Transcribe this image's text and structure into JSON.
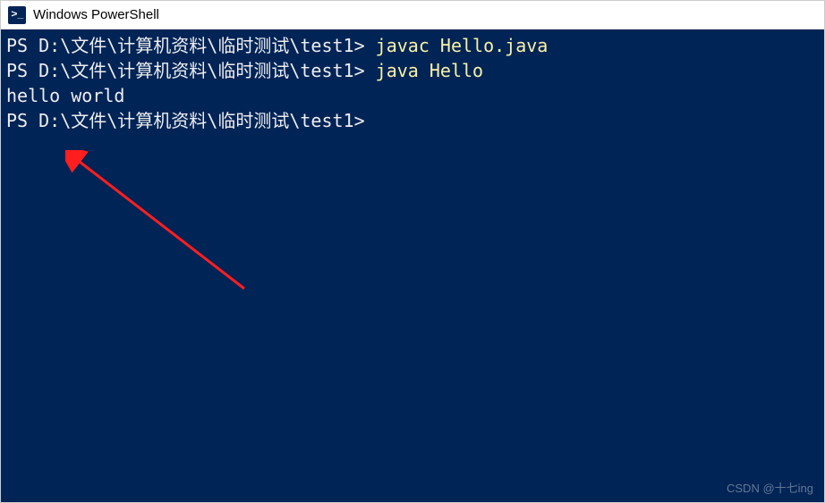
{
  "window": {
    "title": "Windows PowerShell"
  },
  "terminal": {
    "lines": [
      {
        "prompt": "PS D:\\文件\\计算机资料\\临时测试\\test1> ",
        "command": "javac Hello.java"
      },
      {
        "prompt": "PS D:\\文件\\计算机资料\\临时测试\\test1> ",
        "command": "java Hello"
      },
      {
        "output": "hello world"
      },
      {
        "prompt": "PS D:\\文件\\计算机资料\\临时测试\\test1>",
        "command": ""
      }
    ]
  },
  "watermark": "CSDN @十七ing",
  "colors": {
    "terminal_bg": "#012456",
    "prompt_fg": "#eeedf0",
    "command_fg": "#f9f1a5",
    "arrow": "#ff1e1e"
  }
}
